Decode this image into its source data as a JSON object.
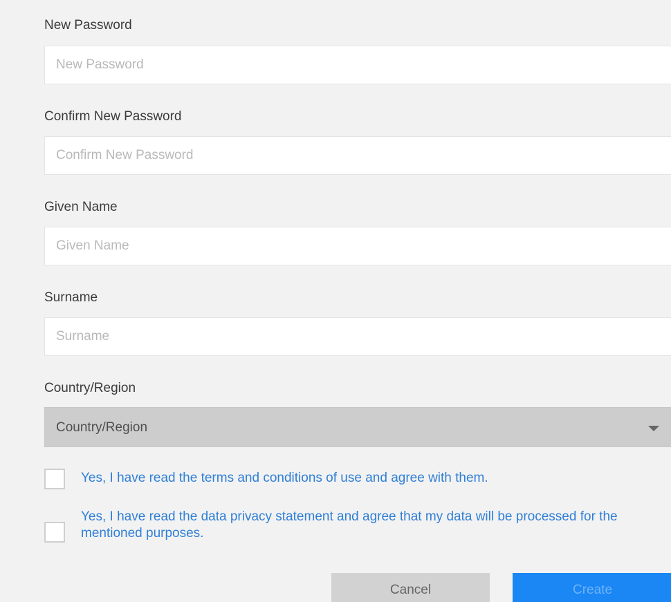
{
  "form": {
    "new_password": {
      "label": "New Password",
      "placeholder": "New Password"
    },
    "confirm_password": {
      "label": "Confirm New Password",
      "placeholder": "Confirm New Password"
    },
    "given_name": {
      "label": "Given Name",
      "placeholder": "Given Name"
    },
    "surname": {
      "label": "Surname",
      "placeholder": "Surname"
    },
    "country": {
      "label": "Country/Region",
      "selected": "Country/Region"
    },
    "checkboxes": [
      {
        "text": "Yes, I have read the terms and conditions of use and agree with them.",
        "checked": false
      },
      {
        "text": "Yes, I have read the data privacy statement and agree that my data will be processed for the mentioned purposes.",
        "checked": false
      }
    ]
  },
  "buttons": {
    "cancel_label": "Cancel",
    "create_label": "Create"
  },
  "colors": {
    "link_text": "#2f7fd6",
    "primary_button": "#1a87f5",
    "secondary_button": "#d2d2d2",
    "select_background": "#cdcdcd"
  }
}
